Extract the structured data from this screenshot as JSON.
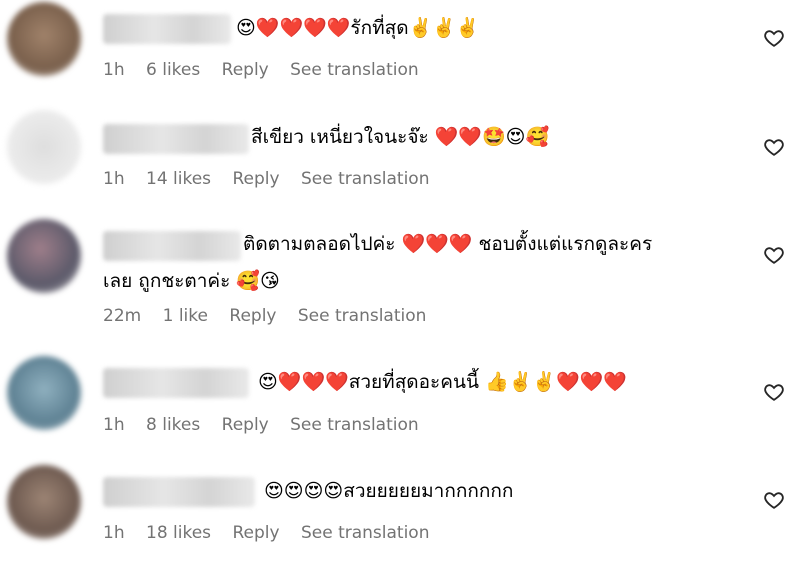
{
  "comments": [
    {
      "text": "😍❤️❤️❤️❤️รักที่สุด✌️✌️✌️",
      "text2": "",
      "time": "1h",
      "likes": "6 likes",
      "reply": "Reply",
      "translate": "See translation",
      "avatar_color": "#8a6e58"
    },
    {
      "text": "สีเขียว เหนี่ยวใจนะจ๊ะ ❤️❤️🤩😍🥰",
      "text2": "",
      "time": "1h",
      "likes": "14 likes",
      "reply": "Reply",
      "translate": "See translation",
      "avatar_color": "#d9d9d9"
    },
    {
      "text": "ติดตามตลอดไปค่ะ ❤️❤️❤️ ชอบตั้งแต่แรกดูละคร",
      "text2": "เลย ถูกชะตาค่ะ 🥰😘",
      "time": "22m",
      "likes": "1 like",
      "reply": "Reply",
      "translate": "See translation",
      "avatar_color": "#7b6a74"
    },
    {
      "text": "😍❤️❤️❤️สวยที่สุดอะคนนี้ 👍✌️✌️❤️❤️❤️",
      "text2": "",
      "time": "1h",
      "likes": "8 likes",
      "reply": "Reply",
      "translate": "See translation",
      "avatar_color": "#6e8e9c"
    },
    {
      "text": "😍😍😍😍สวยยยยยมากกกกกก",
      "text2": "",
      "time": "1h",
      "likes": "18 likes",
      "reply": "Reply",
      "translate": "See translation",
      "avatar_color": "#8a7468"
    }
  ]
}
